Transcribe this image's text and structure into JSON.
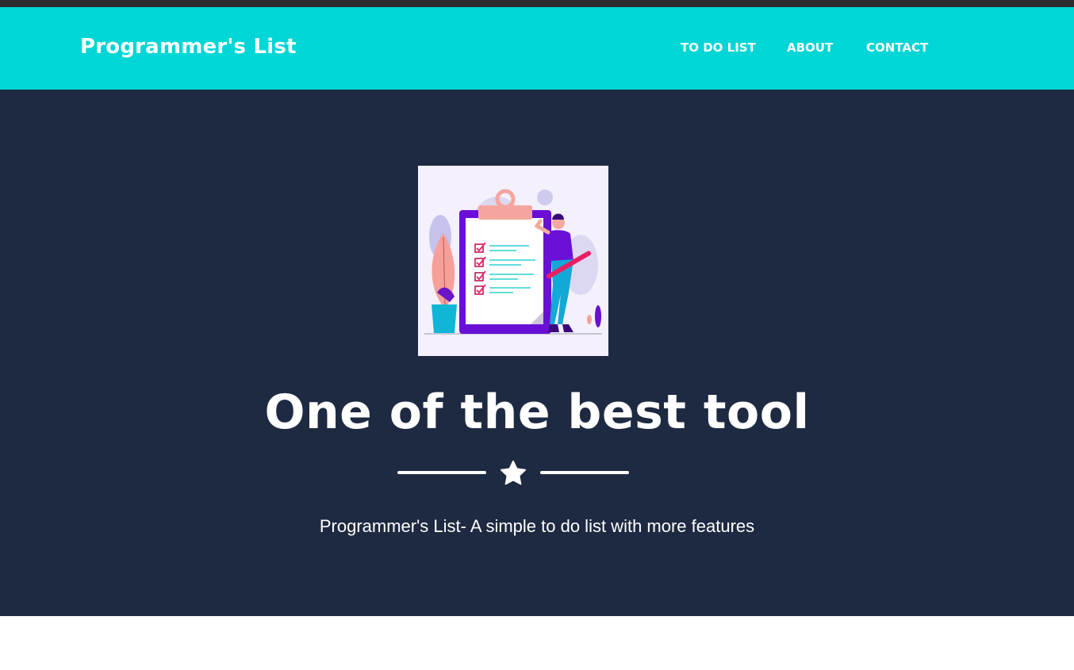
{
  "navbar": {
    "brand": "Programmer's List",
    "links": [
      {
        "label": "TO DO LIST"
      },
      {
        "label": "ABOUT"
      },
      {
        "label": "CONTACT"
      }
    ]
  },
  "hero": {
    "image_icon": "todo-clipboard-illustration",
    "title": "One of the best tool",
    "divider_icon": "star-icon",
    "subtitle": "Programmer's List- A simple to do list with more features"
  },
  "colors": {
    "top_strip": "#2c2c2c",
    "navbar_bg": "#00d6d6",
    "hero_bg": "#1e2a42",
    "text": "#ffffff"
  }
}
